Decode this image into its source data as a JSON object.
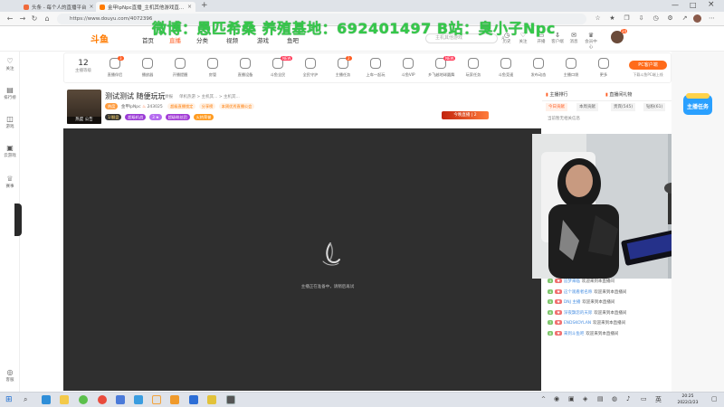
{
  "browser": {
    "tabs": [
      {
        "label": "头条 - 每个人的直播平台"
      },
      {
        "label": "金甲lpNpc直播_主机其他游戏直..."
      }
    ],
    "url": "https://www.douyu.com/4072396"
  },
  "overlay_text": "微博：愚匹希桑 养殖基地：692401497 B站：臭小子Npc",
  "header": {
    "logo": "斗鱼",
    "nav": [
      "首页",
      "直播",
      "分类",
      "视频",
      "游戏",
      "鱼吧"
    ],
    "search_placeholder": "主机其他游戏",
    "icons": [
      {
        "label": "历史",
        "icon": "clock-icon"
      },
      {
        "label": "关注",
        "icon": "heart-icon"
      },
      {
        "label": "开播",
        "icon": "video-icon"
      },
      {
        "label": "客户端",
        "icon": "download-icon"
      },
      {
        "label": "消息",
        "icon": "bell-icon"
      },
      {
        "label": "会员中心",
        "icon": "crown-icon"
      }
    ],
    "avatar_badge": "24",
    "colors": {
      "accent": "#ff5d23",
      "logo": "#ff7a00",
      "overlay": "#35c84a"
    }
  },
  "leftbar": {
    "items": [
      {
        "label": "关注",
        "icon": "heart-icon"
      },
      {
        "label": "排行榜",
        "icon": "rank-icon"
      },
      {
        "label": "游戏",
        "icon": "gamepad-icon"
      },
      {
        "label": "云游戏",
        "icon": "cloud-game-icon"
      },
      {
        "label": "赛事",
        "icon": "trophy-icon"
      }
    ],
    "bottom": {
      "label": "客服",
      "icon": "headset-icon"
    }
  },
  "toolbar": {
    "level": "12",
    "level_label": "主播等级",
    "tools": [
      {
        "label": "直播伴侣",
        "badge": "3"
      },
      {
        "label": "播放器"
      },
      {
        "label": "开播提醒"
      },
      {
        "label": "房管"
      },
      {
        "label": "直播设备"
      },
      {
        "label": "斗鱼全民",
        "badge": "NEW"
      },
      {
        "label": "全民守护"
      },
      {
        "label": "主播任务",
        "badge": "2"
      },
      {
        "label": "上车一起玩"
      },
      {
        "label": "斗鱼VIP"
      },
      {
        "label": "乡飞越地球圆舞",
        "badge": "NEW"
      },
      {
        "label": "玩家任务"
      },
      {
        "label": "斗鱼竞速"
      },
      {
        "label": "发布动态"
      },
      {
        "label": "主播口袋"
      },
      {
        "label": "更多"
      }
    ],
    "pc_button": "PC客户端",
    "pc_sub": "下载斗鱼PC端上线"
  },
  "room": {
    "title": "测试测试 随便玩玩",
    "category": "举报",
    "path": "单机热游 > 主机其... > 主机其...",
    "badge": "热度",
    "pic_badge": "热度  公告",
    "streamer": "金甲lpNpc",
    "hot": "243025",
    "tags": [
      "超级直播锁定",
      "分享榜",
      "本周优秀直播公会"
    ],
    "chips": [
      "1/翻盘",
      "超级机战",
      "3 ★",
      "超级粉丝团",
      "火热荣誉"
    ],
    "room_id": "280808",
    "follow": "关注",
    "share": "分享",
    "report": "举报",
    "event": "今晚直播 | 2"
  },
  "player": {
    "message": "主播正在准备中，请稍后再试"
  },
  "rightpanel": {
    "rank_title": "主播排行",
    "gift_title": "直播间礼物",
    "rank_note": "当前暂无相关信息",
    "tabs": [
      "今日贡献",
      "本周贡献",
      "贵宾(545)",
      "钻粉(61)"
    ],
    "chat": [
      {
        "lv": "3",
        "name": "追梦来临",
        "text": "欢迎来到本直播间"
      },
      {
        "lv": "4",
        "name": "这个观看者名称",
        "text": "欢迎来到本直播间"
      },
      {
        "lv": "5",
        "name": "DNJ 主播",
        "text": "欢迎来到本直播间"
      },
      {
        "lv": "6",
        "name": "深夜飘忽的天际",
        "text": "欢迎来到本直播间"
      },
      {
        "lv": "7",
        "name": "ENDSKOYLAN",
        "text": "欢迎来到本直播间"
      },
      {
        "lv": "8",
        "name": "来到斗鱼吧",
        "text": "欢迎来到本直播间"
      }
    ]
  },
  "rightbar": {
    "mission": "主播任务"
  },
  "taskbar": {
    "time": "20:25",
    "date": "2022/2/23"
  }
}
